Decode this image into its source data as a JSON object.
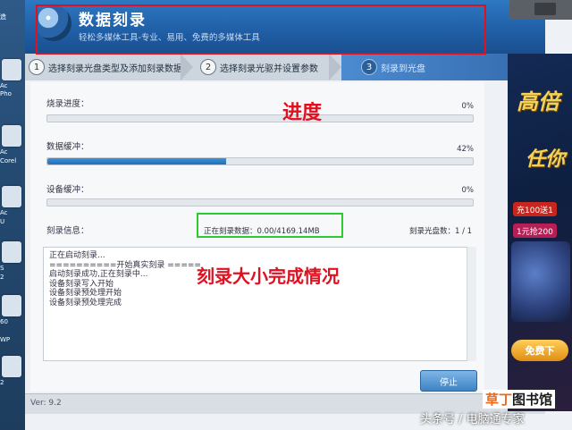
{
  "desktop": {
    "labels": [
      "造",
      "Ac",
      "Pho",
      "Ac",
      "Corel",
      "Ac",
      "U",
      "S",
      "2",
      "60",
      "WP",
      "2"
    ]
  },
  "app": {
    "title": "数据刻录",
    "subtitle": "轻松多媒体工具-专业、易用、免费的多媒体工具",
    "steps": [
      {
        "num": "1",
        "label": "选择刻录光盘类型及添加刻录数据"
      },
      {
        "num": "2",
        "label": "选择刻录光驱并设置参数"
      },
      {
        "num": "3",
        "label": "刻录到光盘"
      }
    ],
    "progress": {
      "burn_label": "烧录进度：",
      "burn_pct_text": "0%",
      "burn_value": 0,
      "data_buffer_label": "数据缓冲：",
      "data_buffer_pct_text": "42%",
      "data_buffer_value": 42,
      "device_buffer_label": "设备缓冲：",
      "device_buffer_pct_text": "0%",
      "device_buffer_value": 0
    },
    "info": {
      "label": "刻录信息：",
      "data_status": "正在刻录数据：0.00/4169.14MB",
      "disc_count": "刻录光盘数：1 / 1"
    },
    "log_lines": [
      "正在启动刻录...",
      "==========开始真实刻录 =====",
      "启动刻录成功,正在刻录中...",
      "设备刻录写入开始",
      "设备刻录预处理开始",
      "设备刻录预处理完成"
    ],
    "stop_button": "停止",
    "version": "Ver: 9.2"
  },
  "annotations": {
    "progress": "进度",
    "size_status": "刻录大小完成情况"
  },
  "ad": {
    "big1": "高倍",
    "big2": "任你",
    "pill1": "充100送1",
    "pill2": "1元抢200",
    "free": "免费下"
  },
  "watermark": {
    "logo_a": "草丁",
    "logo_b": "图书馆",
    "text": "头条号 / 电脑通专家"
  },
  "colors": {
    "annotation_red": "#e01020",
    "annotation_green": "#2ccc30",
    "title_blue": "#1f5ea5"
  }
}
